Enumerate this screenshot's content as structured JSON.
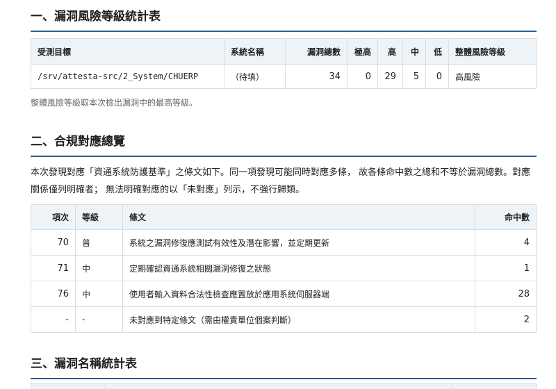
{
  "section1": {
    "title": "一、漏洞風險等級統計表",
    "headers": [
      "受測目標",
      "系統名稱",
      "漏洞總數",
      "極高",
      "高",
      "中",
      "低",
      "整體風險等級"
    ],
    "row": [
      "/srv/attesta-src/2_System/CHUERP",
      "（待填）",
      "34",
      "0",
      "29",
      "5",
      "0",
      "高風險"
    ],
    "note": "整體風險等級取本次檢出漏洞中的最高等級。"
  },
  "section2": {
    "title": "二、合規對應總覽",
    "paragraph": "本次發現對應「資通系統防護基準」之條文如下。同一項發現可能同時對應多條， 故各條命中數之總和不等於漏洞總數。對應關係僅列明確者； 無法明確對應的以「未對應」列示，不強行歸類。",
    "headers": [
      "項次",
      "等級",
      "條文",
      "命中數"
    ],
    "rows": [
      [
        "70",
        "普",
        "系統之漏洞修復應測試有效性及潛在影響，並定期更新",
        "4"
      ],
      [
        "71",
        "中",
        "定期確認資通系統相關漏洞修復之狀態",
        "1"
      ],
      [
        "76",
        "中",
        "使用者輸入資料合法性檢查應置放於應用系統伺服器端",
        "28"
      ],
      [
        "-",
        "-",
        "未對應到特定條文（需由權責單位個案判斷）",
        "2"
      ]
    ]
  },
  "section3": {
    "title": "三、漏洞名稱統計表"
  }
}
